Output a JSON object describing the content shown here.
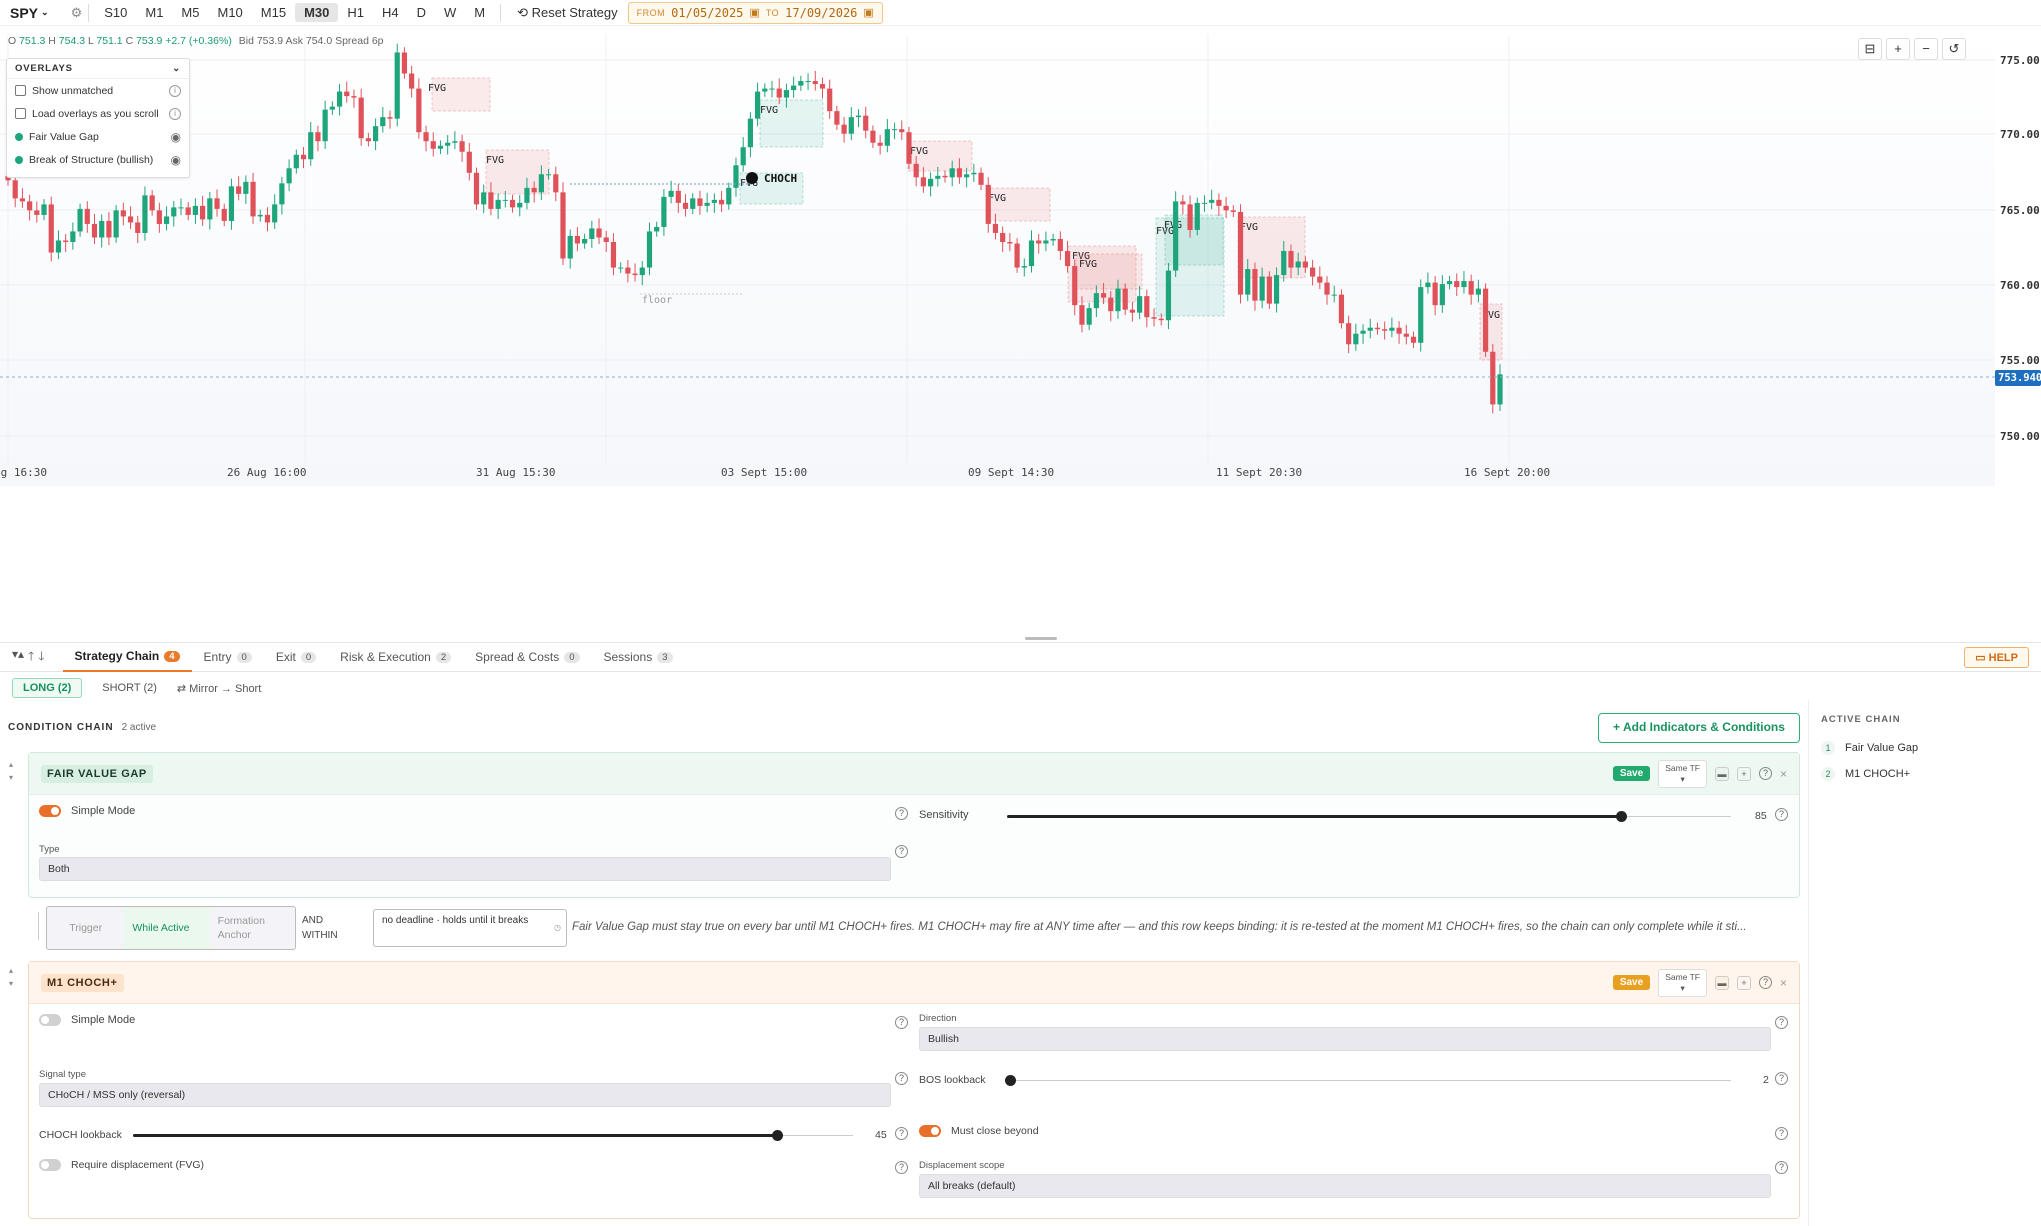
{
  "toolbar": {
    "symbol": "SPY",
    "timeframes": [
      "S10",
      "M1",
      "M5",
      "M10",
      "M15",
      "M30",
      "H1",
      "H4",
      "D",
      "W",
      "M"
    ],
    "active_tf": "M30",
    "reset": "Reset Strategy",
    "from_label": "FROM",
    "from": "01/05/2025",
    "to_label": "TO",
    "to": "17/09/2026"
  },
  "ohlc": {
    "o": "751.3",
    "h": "754.3",
    "l": "751.1",
    "c": "753.9",
    "chg": "+2.7 (+0.36%)",
    "bid": "Bid 753.9 Ask 754.0 Spread 6p"
  },
  "overlays": {
    "title": "OVERLAYS",
    "show_unmatched": "Show unmatched",
    "load_scroll": "Load overlays as you scroll",
    "fvg": "Fair Value Gap",
    "bos": "Break of Structure (bullish)"
  },
  "chart_data": {
    "type": "candlestick",
    "symbol": "SPY",
    "timeframe": "M30",
    "ylim": [
      748,
      777
    ],
    "y_ticks": [
      "775.00",
      "770.00",
      "765.00",
      "760.00",
      "755.00",
      "750.00"
    ],
    "x_ticks": [
      "ug 16:30",
      "26 Aug 16:00",
      "31 Aug 15:30",
      "03 Sept 15:00",
      "09 Sept 14:30",
      "11 Sept 20:30",
      "16 Sept 20:00"
    ],
    "last_price": "753.940",
    "annotations": {
      "choch": "CHOCH",
      "fvg": "FVG",
      "floor": "floor"
    },
    "grid": true,
    "closes": [
      767,
      765.8,
      765.6,
      765,
      764.7,
      765.4,
      762.2,
      763,
      762.9,
      763.6,
      765.1,
      764.1,
      763.2,
      764.3,
      763.2,
      765,
      764.6,
      764.2,
      763.5,
      766,
      765,
      764.1,
      764.6,
      765.2,
      765.2,
      764.7,
      765.3,
      764.4,
      765.8,
      765.1,
      764.3,
      766.6,
      766.1,
      766.9,
      764.6,
      764.7,
      764.2,
      765.4,
      766.8,
      767.8,
      768.7,
      768.4,
      770.2,
      769.6,
      771.7,
      771.9,
      772.9,
      772.6,
      772.5,
      769.8,
      769.6,
      770.6,
      771.2,
      771.1,
      775.5,
      774.1,
      773.1,
      770.2,
      769.6,
      769.1,
      769.3,
      769.5,
      769.6,
      768.9,
      767.5,
      765.4,
      766.2,
      765.1,
      765.7,
      765.7,
      765.2,
      765.5,
      766.5,
      766.2,
      767.4,
      767.4,
      766.2,
      761.8,
      763.3,
      762.8,
      763.1,
      763.8,
      763.2,
      762.9,
      761.2,
      761.2,
      760.8,
      760.7,
      761.2,
      763.6,
      763.9,
      765.9,
      766.3,
      765.5,
      765.1,
      765.8,
      765.3,
      765.5,
      765.7,
      765.4,
      766.5,
      768,
      769.2,
      771.1,
      772.9,
      773.1,
      773.1,
      772.5,
      773,
      773.3,
      773.6,
      773.6,
      773.4,
      773.1,
      771.6,
      770.7,
      770.1,
      771.2,
      771.3,
      770.3,
      769.5,
      769.3,
      770.4,
      770.4,
      770.2,
      768.1,
      767.2,
      766.6,
      767.1,
      767.3,
      767.2,
      767.8,
      767.2,
      767.4,
      767.5,
      766.7,
      764.1,
      763.5,
      762.9,
      762.8,
      761.2,
      761.3,
      763,
      762.8,
      763,
      763.1,
      762.3,
      761.3,
      758.7,
      757.4,
      758.5,
      759.5,
      759.2,
      758.3,
      759.8,
      758.4,
      758.2,
      759.3,
      757.9,
      757.8,
      757.7,
      761,
      765.6,
      765.4,
      763.7,
      765.5,
      765.5,
      765.7,
      765.3,
      765,
      764.9,
      759.4,
      761.1,
      759,
      760.6,
      758.8,
      760.7,
      762.3,
      761.2,
      761.6,
      761.2,
      760.6,
      760.2,
      759.4,
      759.4,
      757.5,
      756.1,
      756.8,
      757,
      757.2,
      757.1,
      757,
      757.2,
      756.8,
      756.6,
      756.2,
      759.9,
      760.2,
      758.7,
      760.1,
      760.3,
      759.9,
      760.3,
      759.4,
      759.8,
      755.6,
      752.1,
      754.1
    ]
  },
  "chart_controls": [
    "⊟",
    "+",
    "−",
    "↺"
  ],
  "tabs": [
    {
      "label": "Strategy Chain",
      "count": "4"
    },
    {
      "label": "Entry",
      "count": "0"
    },
    {
      "label": "Exit",
      "count": "0"
    },
    {
      "label": "Risk & Execution",
      "count": "2"
    },
    {
      "label": "Spread & Costs",
      "count": "0"
    },
    {
      "label": "Sessions",
      "count": "3"
    }
  ],
  "help": "HELP",
  "sides": {
    "long": "LONG (2)",
    "short": "SHORT (2)",
    "mirror": "⇄ Mirror → Short"
  },
  "chain": {
    "title": "CONDITION CHAIN",
    "active": "2 active",
    "add": "+ Add Indicators & Conditions"
  },
  "fvg_card": {
    "title": "FAIR VALUE GAP",
    "save": "Save",
    "same_tf": "Same TF",
    "simple_mode": "Simple Mode",
    "sensitivity_label": "Sensitivity",
    "sensitivity": "85",
    "type_label": "Type",
    "type": "Both"
  },
  "link": {
    "trigger": "Trigger",
    "while_active": "While Active",
    "formation_anchor": "Formation Anchor",
    "and_within": "AND WITHIN",
    "deadline": "no deadline · holds until it breaks",
    "desc": "Fair Value Gap must stay true on every bar until M1 CHOCH+ fires. M1 CHOCH+ may fire at ANY time after — and this row keeps binding: it is re-tested at the moment M1 CHOCH+ fires, so the chain can only complete while it sti..."
  },
  "choch_card": {
    "title": "M1 CHOCH+",
    "save": "Save",
    "same_tf": "Same TF",
    "simple_mode": "Simple Mode",
    "direction_label": "Direction",
    "direction": "Bullish",
    "signal_label": "Signal type",
    "signal": "CHoCH / MSS only (reversal)",
    "bos_label": "BOS lookback",
    "bos": "2",
    "choch_label": "CHOCH lookback",
    "choch": "45",
    "must_close": "Must close beyond",
    "req_disp": "Require displacement (FVG)",
    "disp_scope_label": "Displacement scope",
    "disp_scope": "All breaks (default)"
  },
  "active_chain": {
    "title": "ACTIVE CHAIN",
    "items": [
      {
        "n": "1",
        "label": "Fair Value Gap"
      },
      {
        "n": "2",
        "label": "M1 CHOCH+"
      }
    ]
  }
}
